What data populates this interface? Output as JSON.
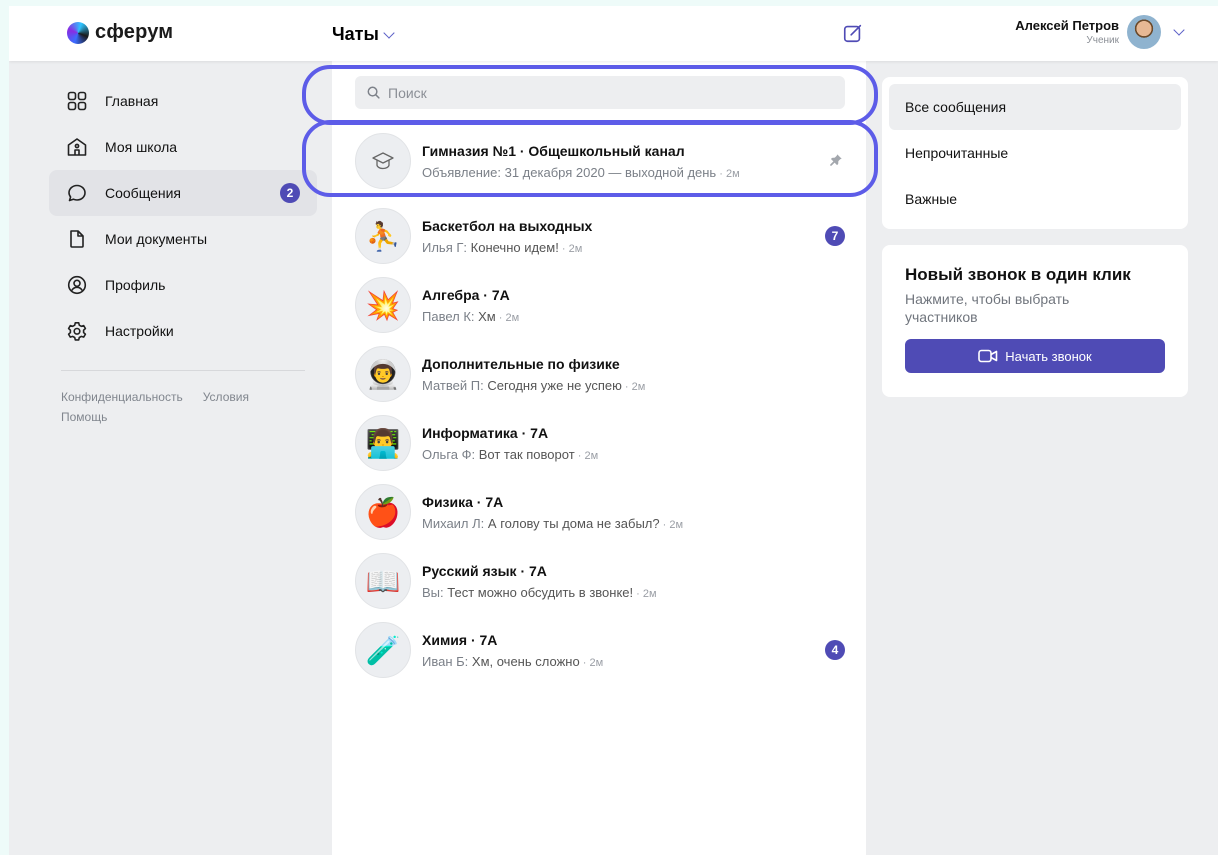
{
  "colors": {
    "accent": "#4f4bb5",
    "highlight": "#5d5ce8",
    "background": "#edeef0"
  },
  "header": {
    "brand": "сферум",
    "section_title": "Чаты",
    "user": {
      "name": "Алексей Петров",
      "role": "Ученик"
    }
  },
  "sidebar": {
    "items": [
      {
        "label": "Главная",
        "icon": "grid-icon"
      },
      {
        "label": "Моя школа",
        "icon": "school-icon"
      },
      {
        "label": "Сообщения",
        "icon": "chat-bubble-icon",
        "badge": "2"
      },
      {
        "label": "Мои документы",
        "icon": "document-icon"
      },
      {
        "label": "Профиль",
        "icon": "profile-icon"
      },
      {
        "label": "Настройки",
        "icon": "gear-icon"
      }
    ],
    "footer": {
      "privacy": "Конфиденциальность",
      "terms": "Условия",
      "help": "Помощь"
    }
  },
  "search": {
    "placeholder": "Поиск"
  },
  "chats": [
    {
      "title": "Гимназия №1 · Общешкольный канал",
      "author": "",
      "message": "Объявление: 31 декабря 2020 — выходной день",
      "time": "2м",
      "pinned": true,
      "avatar": "graduation-cap-icon"
    },
    {
      "title": "Баскетбол на выходных",
      "author": "Илья Г:",
      "message": "Конечно идем!",
      "time": "2м",
      "unread": "7",
      "avatar": "basketball-player-emoji"
    },
    {
      "title": "Алгебра · 7А",
      "author": "Павел К:",
      "message": "Хм",
      "time": "2м",
      "avatar": "explosion-emoji"
    },
    {
      "title": "Дополнительные по физике",
      "author": "Матвей П:",
      "message": "Сегодня уже не успею",
      "time": "2м",
      "avatar": "astronaut-emoji"
    },
    {
      "title": "Информатика · 7А",
      "author": "Ольга Ф:",
      "message": "Вот так поворот",
      "time": "2м",
      "avatar": "technologist-emoji"
    },
    {
      "title": "Физика · 7А",
      "author": "Михаил Л:",
      "message": "А голову ты дома не забыл?",
      "time": "2м",
      "avatar": "apple-emoji"
    },
    {
      "title": "Русский язык · 7А",
      "author": "Вы:",
      "message": "Тест можно обсудить в звонке!",
      "time": "2м",
      "avatar": "open-book-emoji"
    },
    {
      "title": "Химия · 7А",
      "author": "Иван Б:",
      "message": "Хм, очень сложно",
      "time": "2м",
      "unread": "4",
      "avatar": "test-tube-emoji"
    }
  ],
  "filters": [
    "Все сообщения",
    "Непрочитанные",
    "Важные"
  ],
  "call": {
    "title": "Новый звонок в один клик",
    "subtitle": "Нажмите, чтобы выбрать участников",
    "button": "Начать звонок"
  }
}
